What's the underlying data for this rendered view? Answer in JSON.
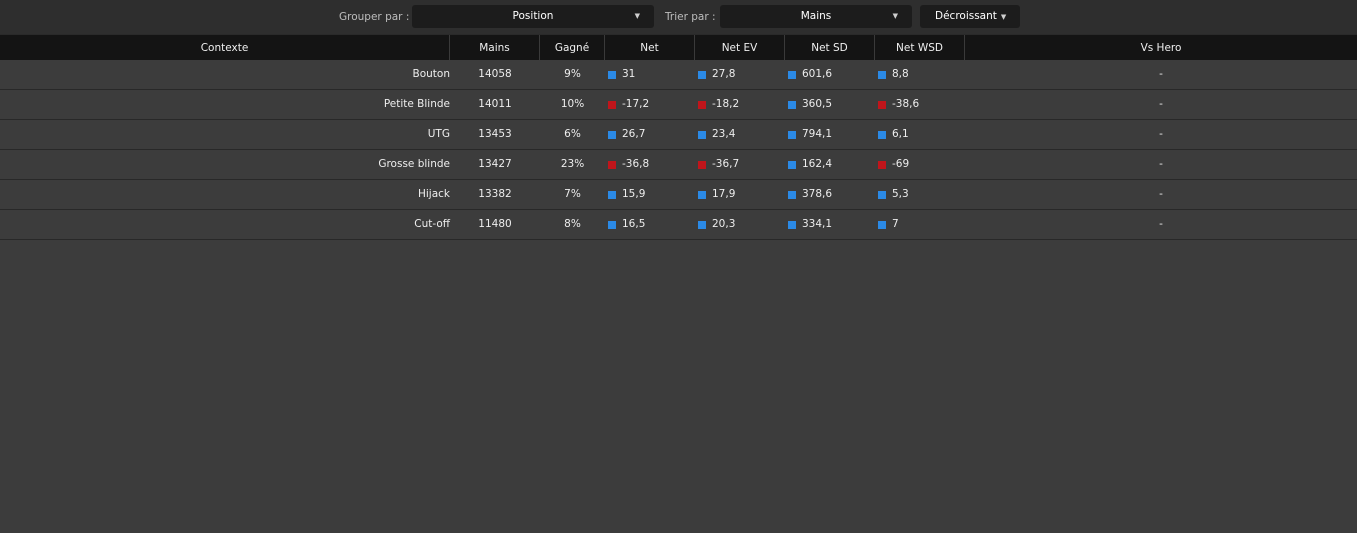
{
  "toolbar": {
    "group_label": "Grouper par :",
    "group_value": "Position",
    "sort_label": "Trier par :",
    "sort_value": "Mains",
    "order_label": "Décroissant"
  },
  "colors": {
    "positive": "#2b8ae6",
    "negative": "#c0151b"
  },
  "columns": [
    "Contexte",
    "Mains",
    "Gagné",
    "Net",
    "Net EV",
    "Net SD",
    "Net WSD",
    "Vs Hero"
  ],
  "rows": [
    {
      "contexte": "Bouton",
      "mains": "14058",
      "gagne": "9%",
      "net": "31",
      "net_ev": "27,8",
      "net_sd": "601,6",
      "net_wsd": "8,8",
      "vs_hero": "-",
      "net_sign": "positive",
      "net_ev_sign": "positive",
      "net_sd_sign": "positive",
      "net_wsd_sign": "positive"
    },
    {
      "contexte": "Petite Blinde",
      "mains": "14011",
      "gagne": "10%",
      "net": "-17,2",
      "net_ev": "-18,2",
      "net_sd": "360,5",
      "net_wsd": "-38,6",
      "vs_hero": "-",
      "net_sign": "negative",
      "net_ev_sign": "negative",
      "net_sd_sign": "positive",
      "net_wsd_sign": "negative"
    },
    {
      "contexte": "UTG",
      "mains": "13453",
      "gagne": "6%",
      "net": "26,7",
      "net_ev": "23,4",
      "net_sd": "794,1",
      "net_wsd": "6,1",
      "vs_hero": "-",
      "net_sign": "positive",
      "net_ev_sign": "positive",
      "net_sd_sign": "positive",
      "net_wsd_sign": "positive"
    },
    {
      "contexte": "Grosse blinde",
      "mains": "13427",
      "gagne": "23%",
      "net": "-36,8",
      "net_ev": "-36,7",
      "net_sd": "162,4",
      "net_wsd": "-69",
      "vs_hero": "-",
      "net_sign": "negative",
      "net_ev_sign": "negative",
      "net_sd_sign": "positive",
      "net_wsd_sign": "negative"
    },
    {
      "contexte": "Hijack",
      "mains": "13382",
      "gagne": "7%",
      "net": "15,9",
      "net_ev": "17,9",
      "net_sd": "378,6",
      "net_wsd": "5,3",
      "vs_hero": "-",
      "net_sign": "positive",
      "net_ev_sign": "positive",
      "net_sd_sign": "positive",
      "net_wsd_sign": "positive"
    },
    {
      "contexte": "Cut-off",
      "mains": "11480",
      "gagne": "8%",
      "net": "16,5",
      "net_ev": "20,3",
      "net_sd": "334,1",
      "net_wsd": "7",
      "vs_hero": "-",
      "net_sign": "positive",
      "net_ev_sign": "positive",
      "net_sd_sign": "positive",
      "net_wsd_sign": "positive"
    }
  ]
}
